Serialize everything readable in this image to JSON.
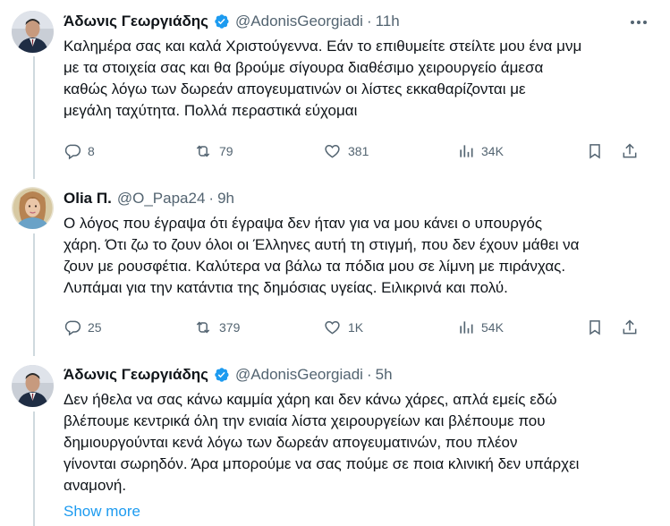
{
  "tweets": [
    {
      "author": "Άδωνις Γεωργιάδης",
      "handle": "@AdonisGeorgiadi",
      "time": "11h",
      "verified": true,
      "text": "Καλημέρα σας και καλά Χριστούγεννα. Εάν το επιθυμείτε στείλτε μου ένα μνμ\nμε τα στοιχεία σας και θα βρούμε σίγουρα διαθέσιμο χειρουργείο άμεσα\nκαθώς λόγω των δωρεάν απογευματινών οι λίστες εκκαθαρίζονται με\nμεγάλη ταχύτητα. Πολλά περαστικά εύχομαι",
      "replies": "8",
      "reposts": "79",
      "likes": "381",
      "views": "34K"
    },
    {
      "author": "Olia Π.",
      "handle": "@O_Papa24",
      "time": "9h",
      "verified": false,
      "text": "Ο λόγος που έγραψα ότι έγραψα δεν ήταν για να μου κάνει ο υπουργός\nχάρη. Ότι ζω το ζουν όλοι οι Έλληνες αυτή τη στιγμή, που δεν έχουν μάθει να\nζουν με ρουσφέτια. Καλύτερα να βάλω τα πόδια μου σε λίμνη με πιράνχας.\nΛυπάμαι για την κατάντια της δημόσιας υγείας. Ειλικρινά και πολύ.",
      "replies": "25",
      "reposts": "379",
      "likes": "1K",
      "views": "54K"
    },
    {
      "author": "Άδωνις Γεωργιάδης",
      "handle": "@AdonisGeorgiadi",
      "time": "5h",
      "verified": true,
      "text": "Δεν ήθελα να σας κάνω καμμία χάρη και δεν κάνω χάρες, απλά εμείς εδώ\nβλέπουμε κεντρικά όλη την ενιαία λίστα χειρουργείων και βλέπουμε που\nδημιουργούνται κενά λόγω των δωρεάν απογευματινών, που πλέον\nγίνονται σωρηδόν. Άρα μπορούμε να σας πούμε σε ποια κλινική δεν υπάρχει\nαναμονή.",
      "show_more": "Show more"
    }
  ],
  "separator": "·",
  "colors": {
    "text": "#0f1419",
    "secondary": "#536471",
    "link": "#1d9bf0",
    "verified": "#1d9bf0",
    "divider": "#eff3f4"
  },
  "icons": {
    "reply": "reply-icon",
    "repost": "repost-icon",
    "like": "heart-icon",
    "views": "views-icon",
    "bookmark": "bookmark-icon",
    "share": "share-icon",
    "more": "more-icon",
    "verified": "verified-badge-icon"
  }
}
